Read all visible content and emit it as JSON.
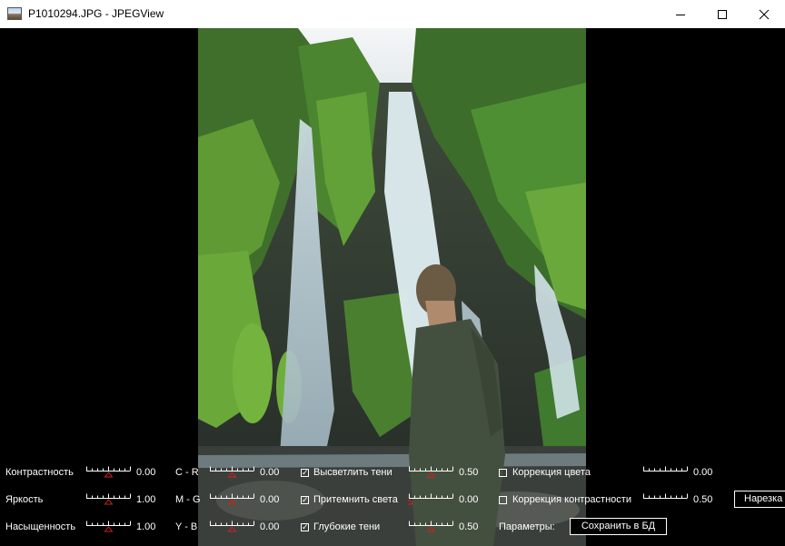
{
  "window": {
    "title": "P1010294.JPG - JPEGView"
  },
  "controls": {
    "col1": [
      {
        "label": "Контрастность",
        "value": "0.00",
        "slider": 0.5
      },
      {
        "label": "Яркость",
        "value": "1.00",
        "slider": 0.5
      },
      {
        "label": "Насыщенность",
        "value": "1.00",
        "slider": 0.5
      }
    ],
    "col2": [
      {
        "label": "C - R",
        "value": "0.00",
        "slider": 0.5
      },
      {
        "label": "M - G",
        "value": "0.00",
        "slider": 0.5
      },
      {
        "label": "Y - B",
        "value": "0.00",
        "slider": 0.5
      }
    ],
    "col3": [
      {
        "label": "Высветлить тени",
        "checked": true,
        "value": "0.50",
        "slider": 0.5
      },
      {
        "label": "Притемнить света",
        "checked": true,
        "value": "0.00",
        "slider": 0.0
      },
      {
        "label": "Глубокие тени",
        "checked": true,
        "value": "0.50",
        "slider": 0.5
      }
    ],
    "col4": [
      {
        "label": "Коррекция цвета",
        "checked": false,
        "value": "0.00"
      },
      {
        "label": "Коррекция контрастности",
        "checked": false,
        "value": "0.50"
      }
    ],
    "params_label": "Параметры:",
    "save_button": "Сохранить в БД",
    "crop_button": "Нарезка"
  }
}
